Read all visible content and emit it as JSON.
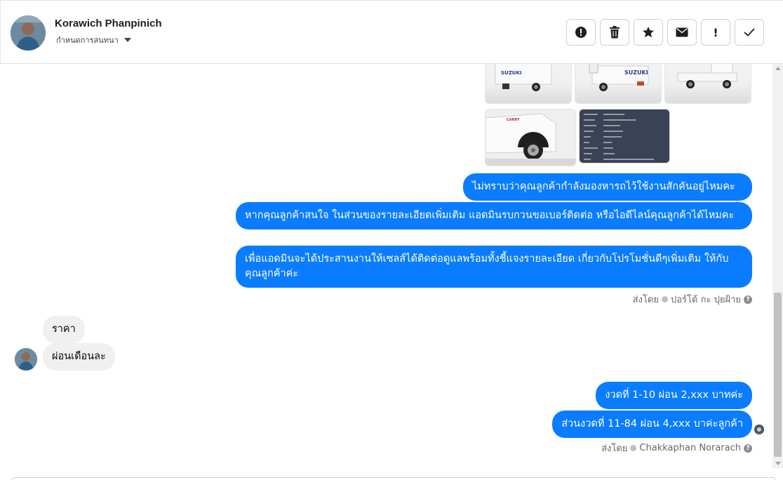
{
  "header": {
    "contact_name": "Korawich Phanpinich",
    "assign_label": "กำหนดการสนทนา",
    "toolbar": [
      {
        "name": "mark-spam-button",
        "icon": "alert-circle-icon"
      },
      {
        "name": "delete-button",
        "icon": "trash-icon"
      },
      {
        "name": "star-button",
        "icon": "star-icon"
      },
      {
        "name": "mark-unread-button",
        "icon": "envelope-icon"
      },
      {
        "name": "follow-up-button",
        "icon": "exclamation-icon",
        "glyph": "!"
      },
      {
        "name": "mark-done-button",
        "icon": "checkmark-icon"
      }
    ]
  },
  "images": {
    "brand_text": "SUZUKI",
    "brand_text_2": "CARRY"
  },
  "messages": {
    "out_1": "ไม่ทราบว่าคุณลูกค้ากำลังมองหารถไว้ใช้งานสักคันอยู่ไหมคะ",
    "out_2": "หากคุณลูกค้าสนใจ ในส่วนของรายละเอียดเพิ่มเติม แอดมินรบกวนขอเบอร์ติดต่อ หรือไอดีไลน์คุณลูกค้าได้ไหมคะ",
    "out_3": "เพื่อแอดมินจะได้ประสานงานให้เซลส์ได้ติดต่อดูแลพร้อมทั้งชี้แจงรายละเอียด เกี่ยวกับโปรโมชั่นดีๆเพิ่มเติม ให้กับคุณลูกค้าค่ะ",
    "sent_by_1_prefix": "ส่งโดย",
    "sent_by_1_name": "ปอร์โต้ กะ ปุยฝ้าย",
    "in_1": "ราคา",
    "in_2": "ผ่อนเดือนละ",
    "out_4": "งวดที่ 1-10 ผ่อน 2,xxx บาทค่ะ",
    "out_5": "ส่วนงวดที่ 11-84 ผ่อน 4,xxx บาค่ะลูกค้า",
    "sent_by_2_prefix": "ส่งโดย",
    "sent_by_2_name": "Chakkaphan Norarach",
    "help_glyph": "?"
  },
  "colors": {
    "outgoing_bubble": "#0a7cff",
    "incoming_bubble": "#f0f0f0"
  }
}
